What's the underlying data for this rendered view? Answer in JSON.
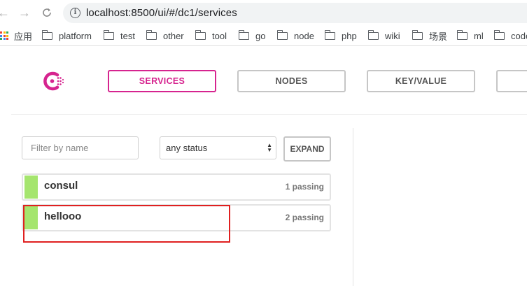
{
  "browser": {
    "url": "localhost:8500/ui/#/dc1/services",
    "back_icon": "arrow-left",
    "forward_icon": "arrow-right",
    "reload_icon": "reload",
    "info_icon": "info"
  },
  "bookmarks": {
    "apps_label": "应用",
    "folders": [
      "platform",
      "test",
      "other",
      "tool",
      "go",
      "node",
      "php",
      "wiki",
      "场景",
      "ml",
      "code"
    ]
  },
  "nav": {
    "services": "SERVICES",
    "nodes": "NODES",
    "key_value": "KEY/VALUE",
    "fourth": ""
  },
  "filters": {
    "name_placeholder": "Filter by name",
    "status_value": "any status",
    "expand_label": "EXPAND"
  },
  "services": [
    {
      "name": "consul",
      "status": "1 passing"
    },
    {
      "name": "hellooo",
      "status": "2 passing"
    }
  ],
  "colors": {
    "brand": "#d6248f",
    "passing": "#a5e56e",
    "highlight": "#e02020"
  }
}
